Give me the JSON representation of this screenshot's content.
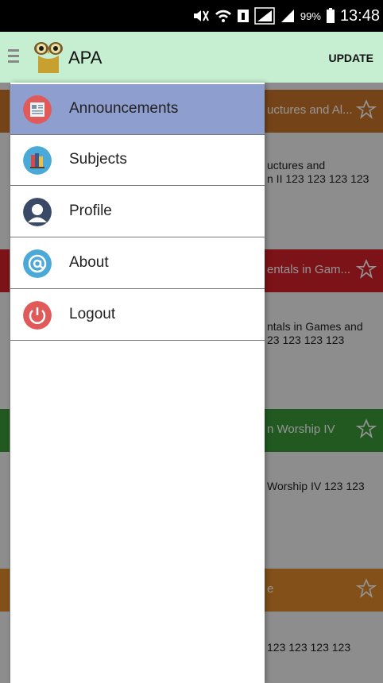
{
  "status_bar": {
    "battery": "99%",
    "time": "13:48"
  },
  "app_bar": {
    "title": "APA",
    "logo_text": "APA",
    "action": "UPDATE"
  },
  "drawer": {
    "items": [
      {
        "label": "Announcements",
        "icon": "newspaper-icon",
        "color": "#e05a5a",
        "active": true
      },
      {
        "label": "Subjects",
        "icon": "books-icon",
        "color": "#4aa9d6",
        "active": false
      },
      {
        "label": "Profile",
        "icon": "user-icon",
        "color": "#3a4a66",
        "active": false
      },
      {
        "label": "About",
        "icon": "at-icon",
        "color": "#4aa9d6",
        "active": false
      },
      {
        "label": "Logout",
        "icon": "power-icon",
        "color": "#e05a5a",
        "active": false
      }
    ]
  },
  "background_cards": [
    {
      "title": "uctures and Al...",
      "color": "#c8762a",
      "body_line1": "uctures and",
      "body_line2": "n II 123 123 123 123"
    },
    {
      "title": "entals in Gam...",
      "color": "#d6222a",
      "body_line1": "ntals in Games and",
      "body_line2": "23 123 123 123"
    },
    {
      "title": "n Worship IV",
      "color": "#3a9a3a",
      "body_line1": "Worship IV 123 123",
      "body_line2": ""
    },
    {
      "title": "e",
      "color": "#e08a2a",
      "body_line1": "123 123 123 123",
      "body_line2": ""
    }
  ],
  "colors": {
    "app_bar": "#c6efd2",
    "drawer_active": "#8e9ecf",
    "status_bar": "#000000"
  }
}
